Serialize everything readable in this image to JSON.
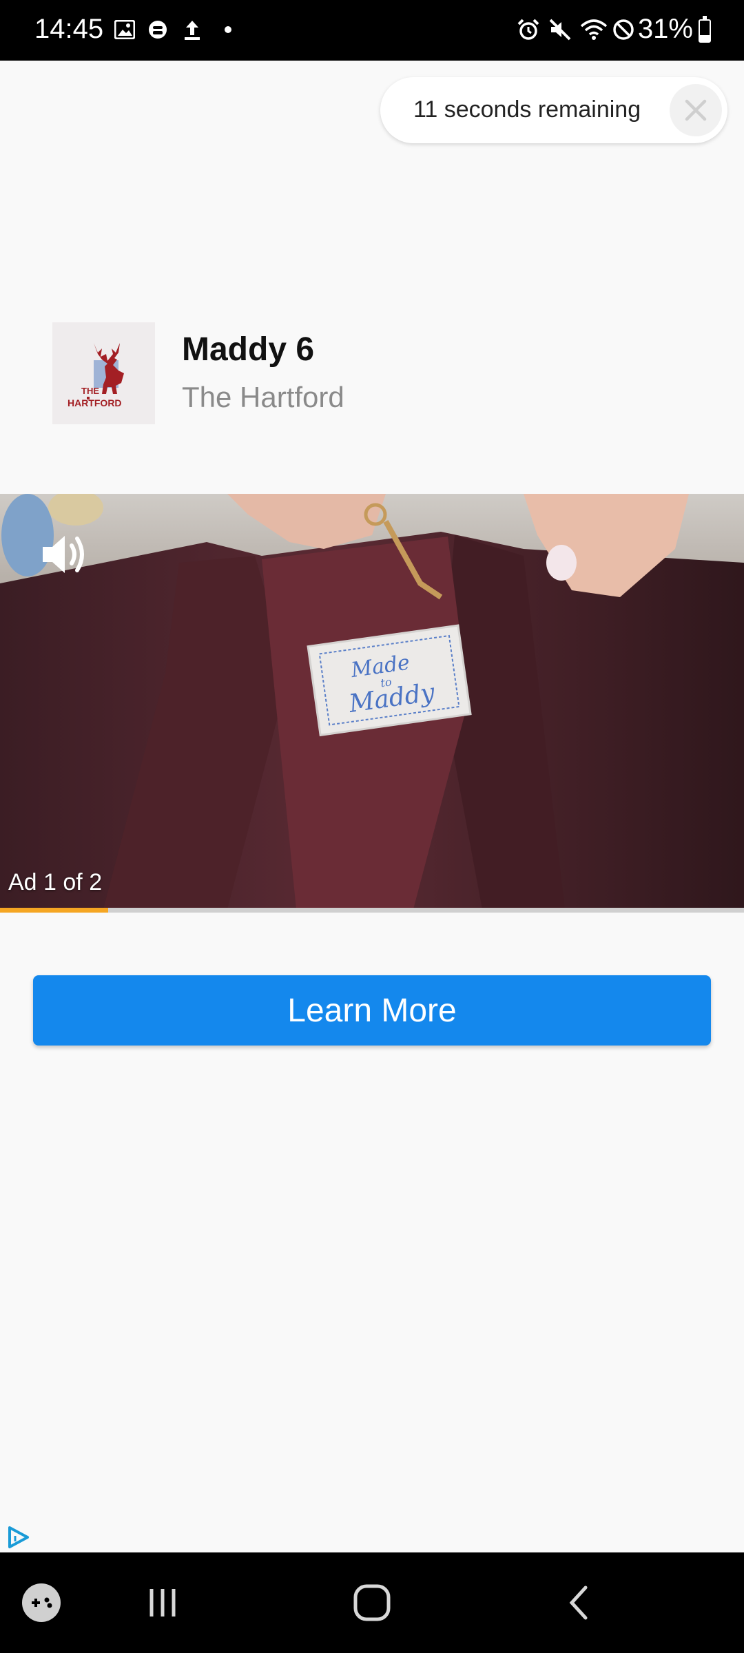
{
  "status_bar": {
    "time": "14:45",
    "battery_percent": "31%",
    "battery_level": 0.31,
    "left_icons": [
      "image-icon",
      "messenger-icon",
      "upload-icon",
      "dot-icon"
    ],
    "right_icons": [
      "alarm-icon",
      "mute-icon",
      "wifi-icon",
      "dnd-icon"
    ]
  },
  "ad_timer": {
    "text": "11 seconds remaining"
  },
  "advertiser": {
    "ad_title": "Maddy 6",
    "name": "The Hartford",
    "logo_text_top": "THE",
    "logo_text_bottom": "HARTFORD"
  },
  "video": {
    "ad_counter": "Ad 1 of 2",
    "label_text_1": "Made",
    "label_text_2": "to",
    "label_text_3": "Maddy",
    "progress": 0.145
  },
  "cta": {
    "label": "Learn More",
    "color": "#1488ed"
  },
  "colors": {
    "progress": "#f5a623",
    "hartford_red": "#a31f24"
  },
  "nav_bar": {
    "buttons": [
      "game-launcher-icon",
      "recents-icon",
      "home-icon",
      "back-icon"
    ]
  }
}
